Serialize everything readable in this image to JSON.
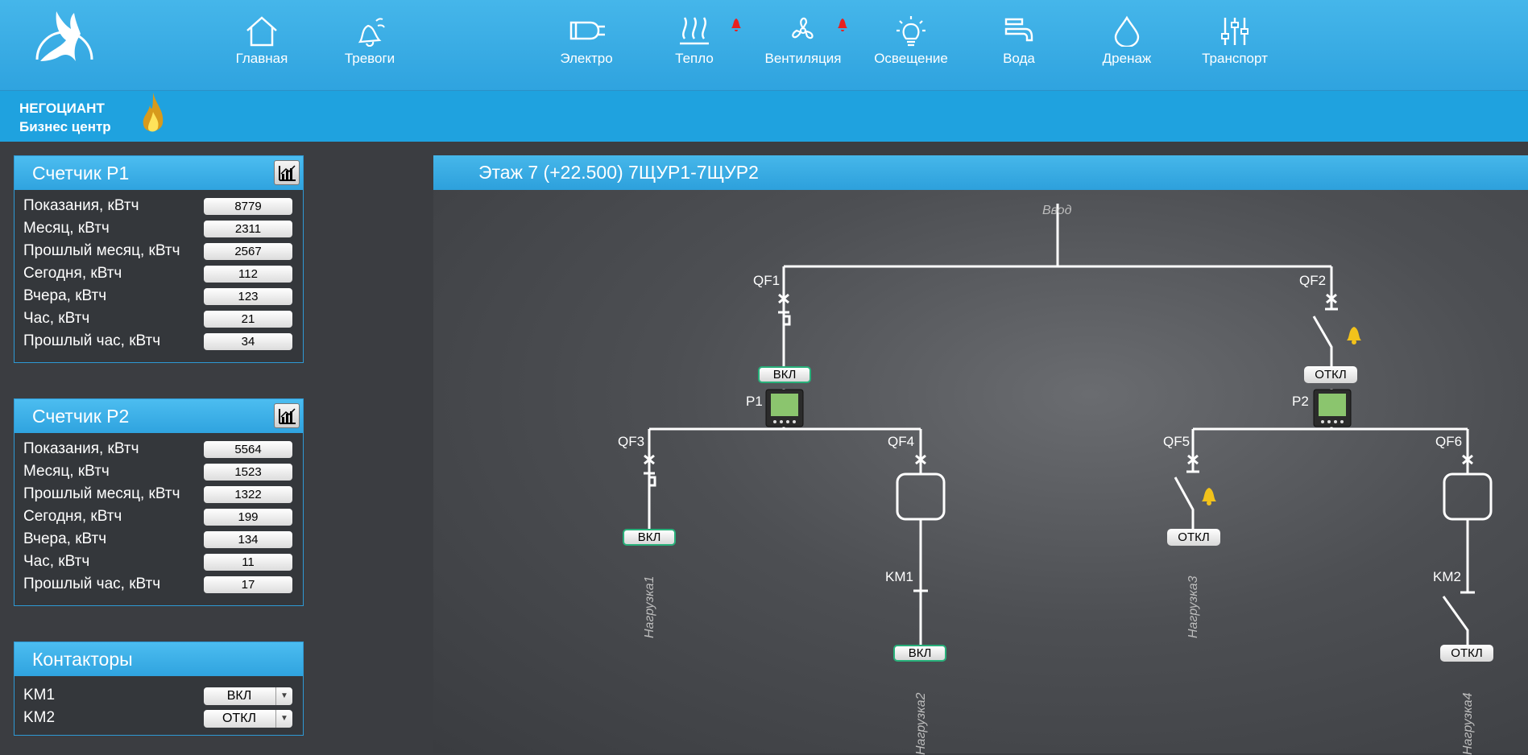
{
  "nav": {
    "items": [
      {
        "label": "Главная",
        "icon": "home-icon"
      },
      {
        "label": "Тревоги",
        "icon": "alarm-bell-icon"
      },
      {
        "label": "Электро",
        "icon": "plug-icon"
      },
      {
        "label": "Тепло",
        "icon": "heat-icon"
      },
      {
        "label": "Вентиляция",
        "icon": "fan-icon"
      },
      {
        "label": "Освещение",
        "icon": "lightbulb-icon"
      },
      {
        "label": "Вода",
        "icon": "faucet-icon"
      },
      {
        "label": "Дренаж",
        "icon": "drop-icon"
      },
      {
        "label": "Транспорт",
        "icon": "sliders-icon"
      }
    ],
    "alert_color": "#e8201e"
  },
  "brand": {
    "line1": "НЕГОЦИАНТ",
    "line2": "Бизнес центр"
  },
  "meter_p1": {
    "title": "Счетчик P1",
    "rows": [
      {
        "label": "Показания, кВтч",
        "value": "8779"
      },
      {
        "label": "Месяц, кВтч",
        "value": "2311"
      },
      {
        "label": "Прошлый месяц, кВтч",
        "value": "2567"
      },
      {
        "label": "Сегодня, кВтч",
        "value": "112"
      },
      {
        "label": "Вчера, кВтч",
        "value": "123"
      },
      {
        "label": "Час, кВтч",
        "value": "21"
      },
      {
        "label": "Прошлый час, кВтч",
        "value": "34"
      }
    ]
  },
  "meter_p2": {
    "title": "Счетчик P2",
    "rows": [
      {
        "label": "Показания, кВтч",
        "value": "5564"
      },
      {
        "label": "Месяц, кВтч",
        "value": "1523"
      },
      {
        "label": "Прошлый месяц, кВтч",
        "value": "1322"
      },
      {
        "label": "Сегодня, кВтч",
        "value": "199"
      },
      {
        "label": "Вчера, кВтч",
        "value": "134"
      },
      {
        "label": "Час, кВтч",
        "value": "11"
      },
      {
        "label": "Прошлый час, кВтч",
        "value": "17"
      }
    ]
  },
  "contactors": {
    "title": "Контакторы",
    "rows": [
      {
        "label": "KM1",
        "value": "ВКЛ"
      },
      {
        "label": "KM2",
        "value": "ОТКЛ"
      }
    ]
  },
  "schema": {
    "title": "Этаж 7 (+22.500) 7ЩУР1-7ЩУР2",
    "input_label": "Ввод",
    "breakers": {
      "qf1": "QF1",
      "qf2": "QF2",
      "qf3": "QF3",
      "qf4": "QF4",
      "qf5": "QF5",
      "qf6": "QF6"
    },
    "meters": {
      "p1": "P1",
      "p2": "P2"
    },
    "contactors": {
      "km1": "KM1",
      "km2": "KM2"
    },
    "states": {
      "qf1": "ВКЛ",
      "qf2": "ОТКЛ",
      "qf3": "ВКЛ",
      "qf5": "ОТКЛ",
      "km1": "ВКЛ",
      "km2": "ОТКЛ"
    },
    "loads": {
      "l1": "Нагрузка1",
      "l2": "Нагрузка2",
      "l3": "Нагрузка3",
      "l4": "Нагрузка4"
    },
    "on_color": "#28b07a",
    "meter_screen_color": "#8bc56e"
  }
}
